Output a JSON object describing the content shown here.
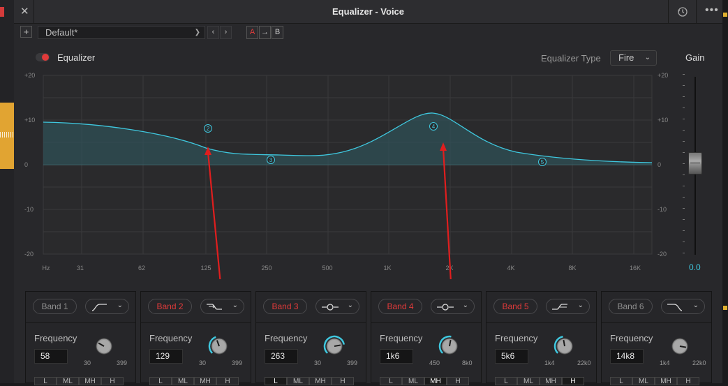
{
  "window": {
    "title": "Equalizer - Voice"
  },
  "toolbar": {
    "preset": "Default*",
    "a_label": "A",
    "arrow_label": "→",
    "b_label": "B"
  },
  "equalizer": {
    "label": "Equalizer",
    "enabled": true,
    "type_label": "Equalizer Type",
    "type_value": "Fire",
    "gain_label": "Gain",
    "gain_value": "0.0"
  },
  "graph": {
    "y_ticks": [
      "+20",
      "+10",
      "0",
      "-10",
      "-20"
    ],
    "x_ticks": [
      "Hz",
      "31",
      "62",
      "125",
      "250",
      "500",
      "1K",
      "2K",
      "4K",
      "8K",
      "16K"
    ],
    "nodes": [
      "2",
      "3",
      "4",
      "5"
    ]
  },
  "bands": [
    {
      "name": "Band 1",
      "on": false,
      "shape": "low-cut",
      "freq_label": "Frequency",
      "freq": "58",
      "min": "30",
      "max": "399"
    },
    {
      "name": "Band 2",
      "on": true,
      "shape": "low-shelf",
      "freq_label": "Frequency",
      "freq": "129",
      "min": "30",
      "max": "399"
    },
    {
      "name": "Band 3",
      "on": true,
      "shape": "bell",
      "freq_label": "Frequency",
      "freq": "263",
      "min": "30",
      "max": "399"
    },
    {
      "name": "Band 4",
      "on": true,
      "shape": "bell",
      "freq_label": "Frequency",
      "freq": "1k6",
      "min": "450",
      "max": "8k0"
    },
    {
      "name": "Band 5",
      "on": true,
      "shape": "high-shelf",
      "freq_label": "Frequency",
      "freq": "5k6",
      "min": "1k4",
      "max": "22k0"
    },
    {
      "name": "Band 6",
      "on": false,
      "shape": "high-cut",
      "freq_label": "Frequency",
      "freq": "14k8",
      "min": "1k4",
      "max": "22k0"
    }
  ],
  "filter_types": [
    "L",
    "ML",
    "MH",
    "H"
  ],
  "colors": {
    "accent": "#3fc8df",
    "active_red": "#e03a3a",
    "annotation_arrow": "#e01e1e"
  }
}
